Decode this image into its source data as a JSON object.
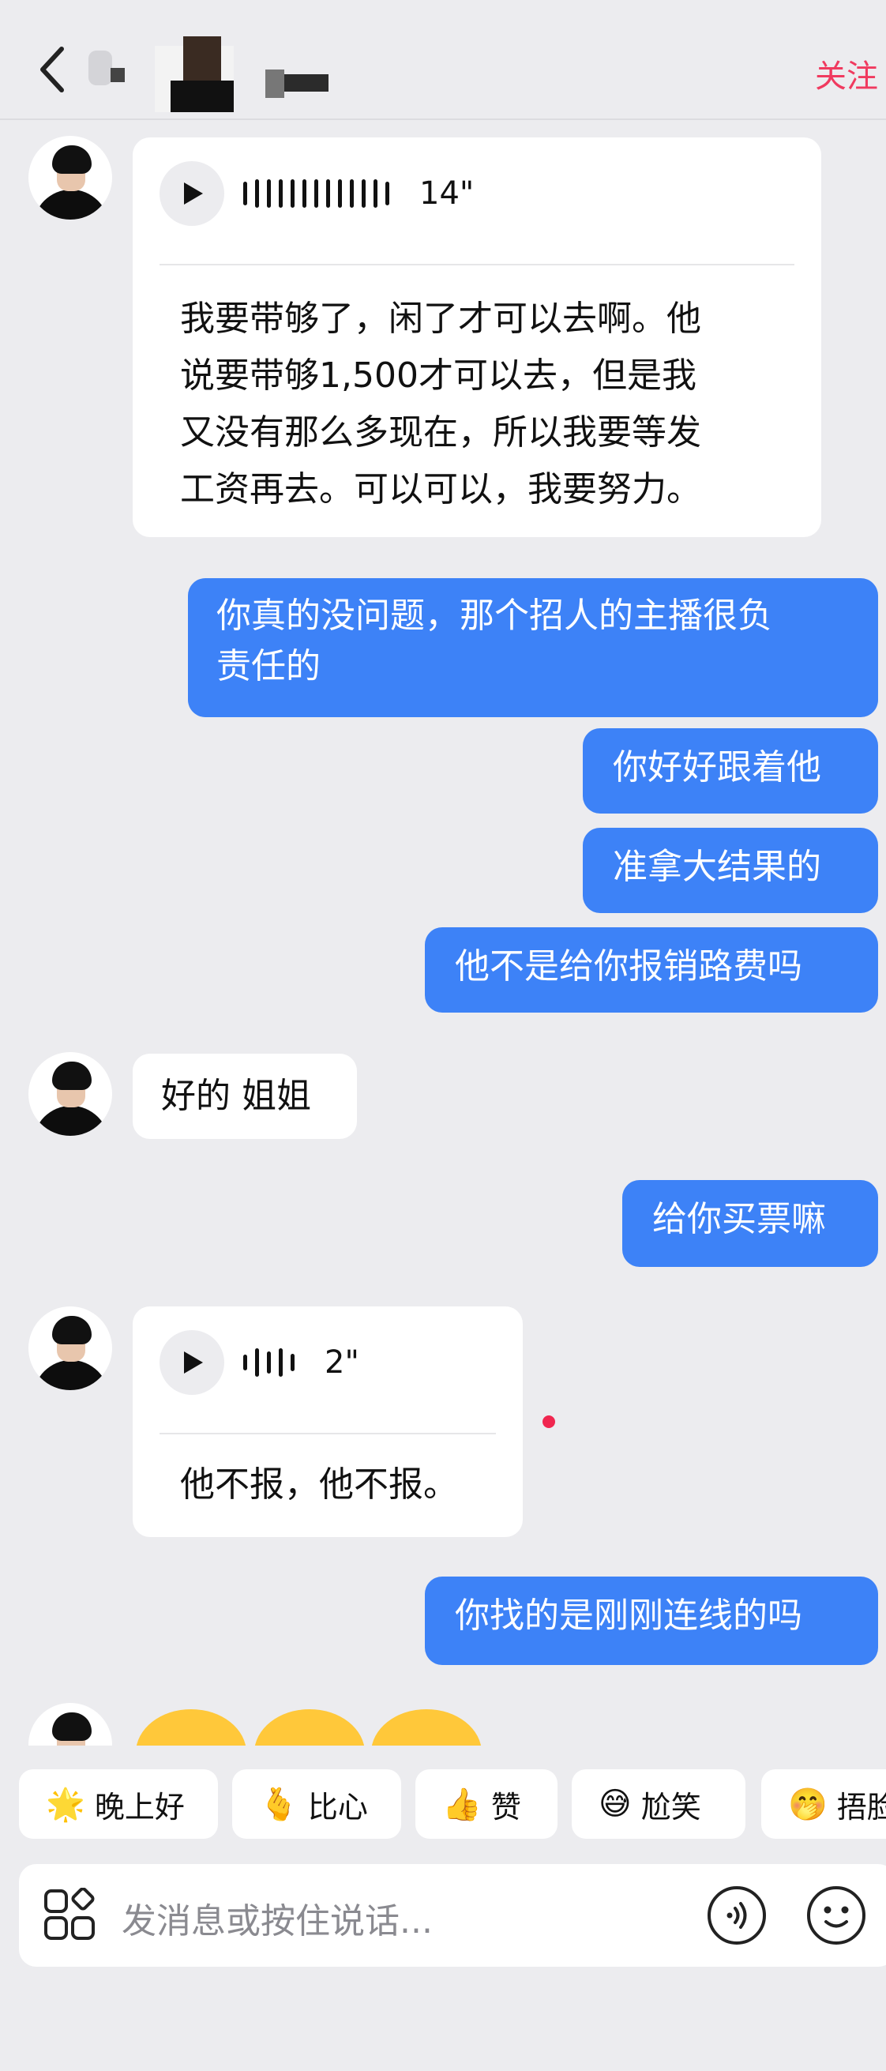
{
  "header": {
    "follow_label": "关注"
  },
  "messages": {
    "voice1": {
      "duration": "14\"",
      "transcript": [
        "我要带够了，闲了才可以去啊。他",
        "说要带够1,500才可以去，但是我",
        "又没有那么多现在，所以我要等发",
        "工资再去。可以可以，我要努力。"
      ]
    },
    "out1": [
      "你真的没问题，那个招人的主播很负",
      "责任的"
    ],
    "out2": "你好好跟着他",
    "out3": "准拿大结果的",
    "out4": "他不是给你报销路费吗",
    "in1": "好的 姐姐",
    "out5": "给你买票嘛",
    "voice2": {
      "duration": "2\"",
      "transcript": "他不报，他不报。"
    },
    "out6": "你找的是刚刚连线的吗"
  },
  "quick_replies": [
    {
      "emoji": "🌟",
      "label": "晚上好"
    },
    {
      "emoji": "🫰",
      "label": "比心"
    },
    {
      "emoji": "👍",
      "label": "赞"
    },
    {
      "emoji": "😅",
      "label": "尬笑"
    },
    {
      "emoji": "🤭",
      "label": "捂脸"
    }
  ],
  "composer": {
    "placeholder": "发消息或按住说话..."
  }
}
